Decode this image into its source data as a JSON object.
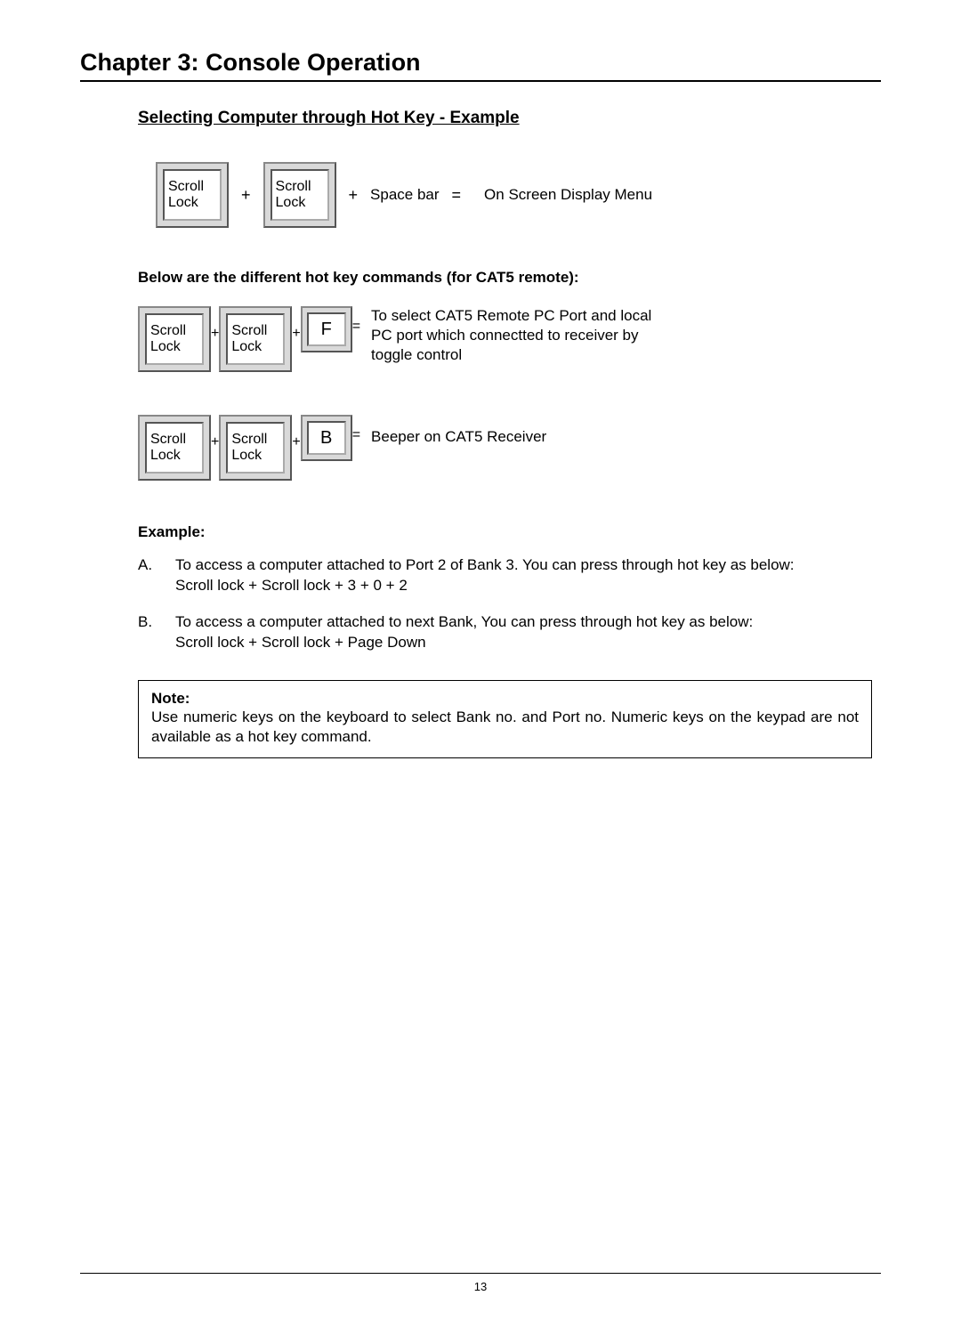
{
  "chapter_title": "Chapter 3: Console Operation",
  "section_title": "Selecting Computer through Hot Key - Example",
  "seq1": {
    "k1": "Scroll Lock",
    "k2": "Scroll Lock",
    "third_label": "Space bar",
    "result": "On Screen Display Menu"
  },
  "subhead": "Below are the different hot key commands (for CAT5 remote):",
  "seq2": {
    "k1": "Scroll Lock",
    "k2": "Scroll Lock",
    "k3": "F",
    "result": "To select CAT5 Remote PC Port and local PC port which connectted to receiver by toggle control"
  },
  "seq3": {
    "k1": "Scroll Lock",
    "k2": "Scroll Lock",
    "k3": "B",
    "result": "Beeper on CAT5 Receiver"
  },
  "symbols": {
    "plus": "+",
    "equals": "="
  },
  "example": {
    "heading": "Example:",
    "items": [
      {
        "letter": "A.",
        "line1": "To access a computer attached to Port 2 of Bank 3. You can press through hot key as below:",
        "line2": "Scroll lock + Scroll lock + 3 + 0 + 2"
      },
      {
        "letter": "B.",
        "line1": "To access a computer attached to next Bank, You can press through hot key as below:",
        "line2": "Scroll lock + Scroll lock + Page Down"
      }
    ]
  },
  "note": {
    "label": "Note:",
    "body": "Use numeric keys on the keyboard to select Bank no. and Port no. Numeric keys on the keypad are not available as a hot key command."
  },
  "page_number": "13"
}
